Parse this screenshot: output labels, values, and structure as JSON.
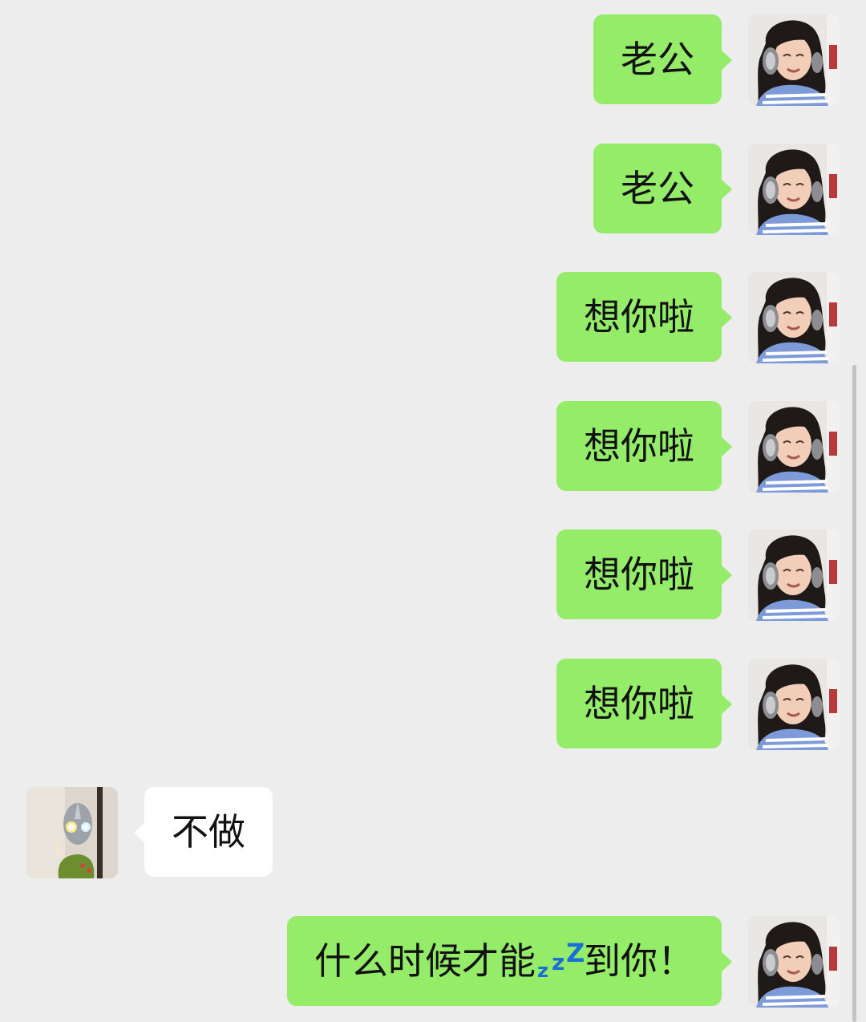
{
  "messages": [
    {
      "side": "sent",
      "text": "老公",
      "avatar": "girl-headphones-avatar"
    },
    {
      "side": "sent",
      "text": "老公",
      "avatar": "girl-headphones-avatar"
    },
    {
      "side": "sent",
      "text": "想你啦",
      "avatar": "girl-headphones-avatar"
    },
    {
      "side": "sent",
      "text": "想你啦",
      "avatar": "girl-headphones-avatar"
    },
    {
      "side": "sent",
      "text": "想你啦",
      "avatar": "girl-headphones-avatar"
    },
    {
      "side": "sent",
      "text": "想你啦",
      "avatar": "girl-headphones-avatar"
    },
    {
      "side": "received",
      "text": "不做",
      "avatar": "ultraman-avatar"
    },
    {
      "side": "sent",
      "text_before": "什么时候才能",
      "emoji": "zzz-sleep-icon",
      "emoji_glyphs": [
        "z",
        "z",
        "Z"
      ],
      "text_after": "到你！",
      "avatar": "girl-headphones-avatar"
    }
  ],
  "colors": {
    "background": "#ededed",
    "sent_bubble": "#95ec69",
    "received_bubble": "#ffffff",
    "emoji_blue": "#1a6fd6"
  }
}
